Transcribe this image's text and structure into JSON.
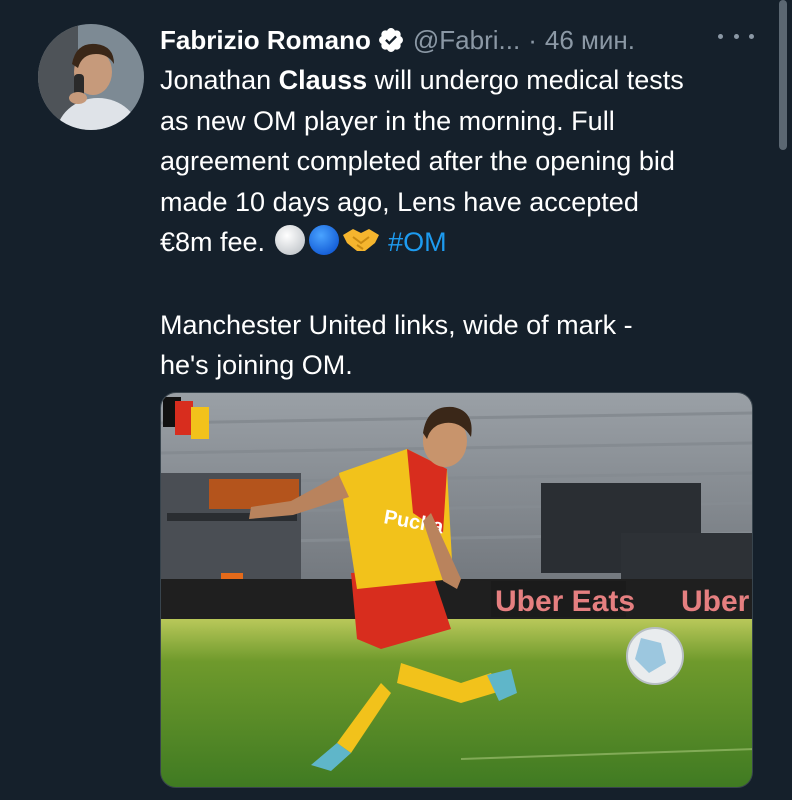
{
  "tweet": {
    "author_name": "Fabrizio Romano",
    "handle": "@Fabri...",
    "separator": "·",
    "time": "46 мин.",
    "text": {
      "l1_a": "Jonathan ",
      "l1_bold": "Clauss",
      "l1_b": " will undergo medical tests",
      "l2": "as new OM player in the morning. Full",
      "l3": "agreement completed after the opening bid",
      "l4": "made 10 days ago, Lens have accepted",
      "l5": "€8m fee. ",
      "hashtag": "#OM",
      "p2_l1": "Manchester United links, wide of mark -",
      "p2_l2": "he's joining OM."
    },
    "media": {
      "ad_boards": [
        "Uber Eats",
        "Uber"
      ],
      "shirt_sponsor": "Pucha"
    }
  },
  "colors": {
    "background": "#15202b",
    "secondary_text": "#8b98a5",
    "link": "#1d9bf0",
    "verified": "#ffffff"
  },
  "icons": {
    "verified": "verified-badge-icon",
    "more": "more-horizontal-icon",
    "emoji_1": "white-circle",
    "emoji_2": "blue-circle",
    "emoji_3": "handshake"
  }
}
